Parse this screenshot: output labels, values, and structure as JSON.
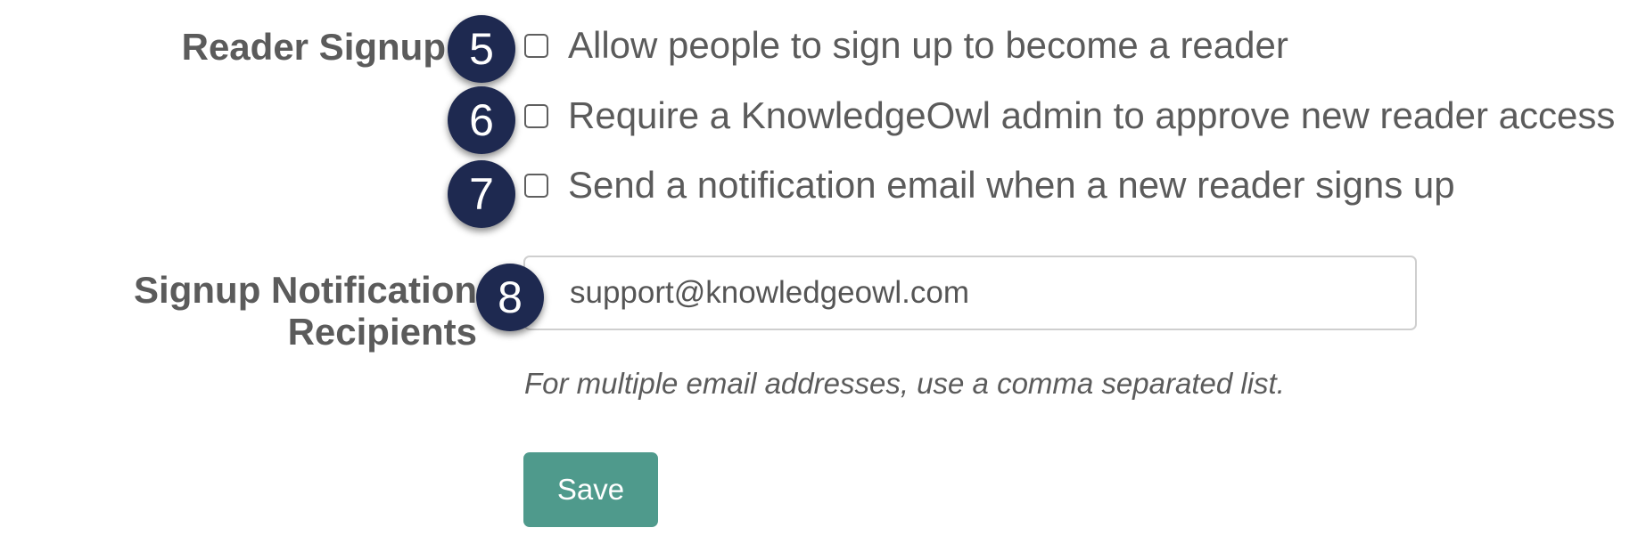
{
  "reader_signup": {
    "label": "Reader Signup",
    "options": [
      {
        "badge": "5",
        "label": "Allow people to sign up to become a reader",
        "checked": false
      },
      {
        "badge": "6",
        "label": "Require a KnowledgeOwl admin to approve new reader access",
        "checked": false
      },
      {
        "badge": "7",
        "label": "Send a notification email when a new reader signs up",
        "checked": false
      }
    ]
  },
  "recipients": {
    "label_line1": "Signup Notification",
    "label_line2": "Recipients",
    "badge": "8",
    "value": "support@knowledgeowl.com",
    "help_text": "For multiple email addresses, use a comma separated list."
  },
  "save_label": "Save",
  "colors": {
    "accent": "#4f9a8c",
    "badge": "#1e2950",
    "text": "#5b5b5b"
  }
}
